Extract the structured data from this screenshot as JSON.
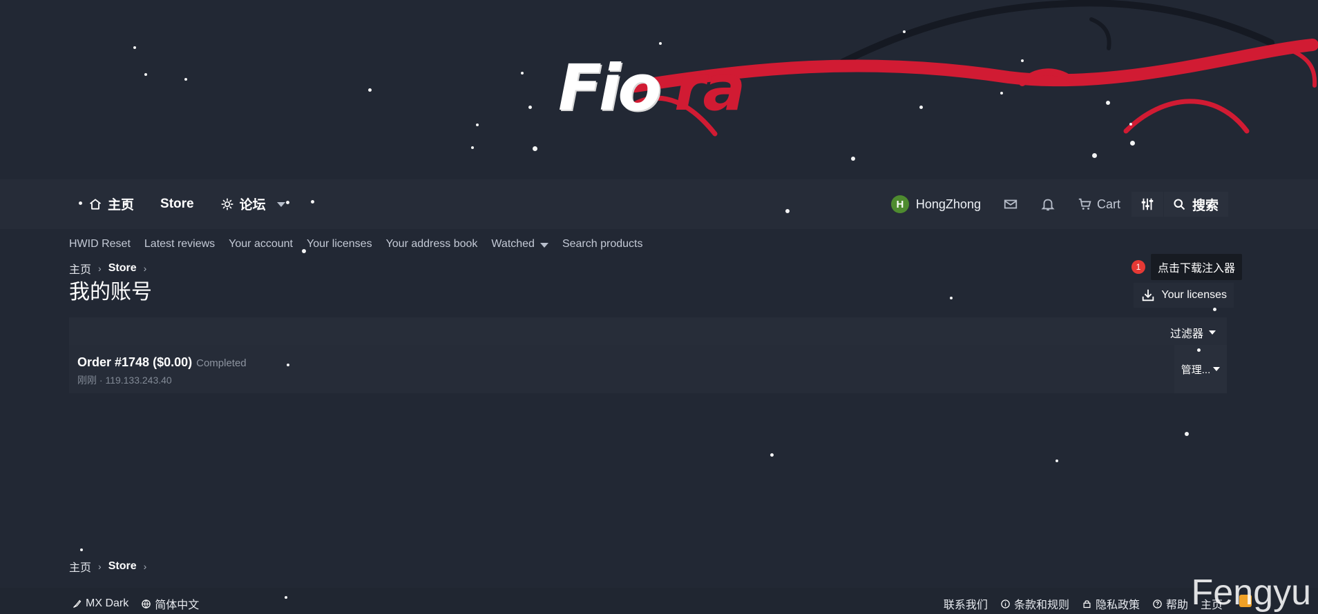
{
  "banner": {
    "logo_left": "Fio",
    "logo_right": "ra"
  },
  "nav": {
    "home": "主页",
    "store": "Store",
    "forum": "论坛",
    "user": {
      "avatar_letter": "H",
      "name": "HongZhong"
    },
    "cart": "Cart",
    "search": "搜索"
  },
  "subnav": {
    "items": [
      "HWID Reset",
      "Latest reviews",
      "Your account",
      "Your licenses",
      "Your address book",
      "Watched",
      "Search products"
    ]
  },
  "breadcrumb": {
    "home": "主页",
    "store": "Store"
  },
  "page": {
    "title": "我的账号"
  },
  "download": {
    "badge": "1",
    "tooltip": "点击下载注入器"
  },
  "licenses_button": "Your licenses",
  "filters": {
    "label": "过滤器"
  },
  "order": {
    "title": "Order #1748 ($0.00)",
    "status": "Completed",
    "meta": "刚刚 · 119.133.243.40",
    "manage": "管理..."
  },
  "footer": {
    "theme": "MX Dark",
    "language": "简体中文",
    "contact": "联系我们",
    "terms": "条款和规则",
    "privacy": "隐私政策",
    "help": "帮助",
    "home": "主页"
  },
  "watermark": "Fengyu",
  "colors": {
    "background": "#222834",
    "panel": "#262c38",
    "accent_red": "#d11b33",
    "badge_red": "#e53935",
    "avatar_green": "#4e8b2f",
    "rss_orange": "#f0a126"
  },
  "icons": {
    "home": "house-icon",
    "forum": "gear-icon",
    "mail": "envelope-icon",
    "notifications": "bell-icon",
    "cart": "cart-icon",
    "tools": "sliders-icon",
    "search": "search-icon",
    "download": "download-icon",
    "theme": "brush-icon",
    "language": "globe-icon",
    "terms": "info-icon",
    "privacy": "lock-icon",
    "help": "question-icon",
    "rss": "rss-icon"
  }
}
